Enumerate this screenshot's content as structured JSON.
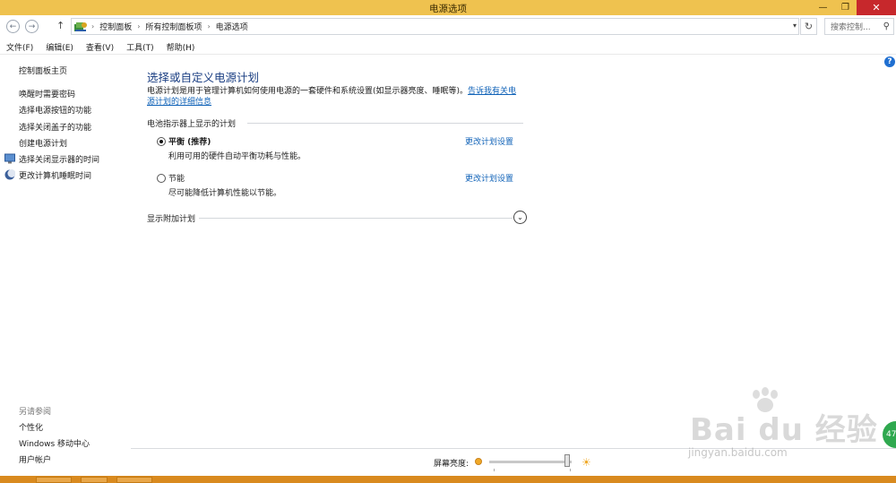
{
  "window": {
    "title": "电源选项",
    "minimize": "—",
    "restore": "❐",
    "close": "✕"
  },
  "nav": {
    "back": "←",
    "forward": "→",
    "up": "↑",
    "breadcrumb": [
      "控制面板",
      "所有控制面板项",
      "电源选项"
    ],
    "breadcrumb_sep": "›",
    "dropdown": "▾",
    "refresh": "↻",
    "search_placeholder": "搜索控制...",
    "search_icon": "⚲"
  },
  "menu": [
    "文件(F)",
    "编辑(E)",
    "查看(V)",
    "工具(T)",
    "帮助(H)"
  ],
  "sidebar": {
    "home": "控制面板主页",
    "links": [
      "唤醒时需要密码",
      "选择电源按钮的功能",
      "选择关闭盖子的功能",
      "创建电源计划",
      "选择关闭显示器的时间",
      "更改计算机睡眠时间"
    ],
    "see_also_title": "另请参阅",
    "see_also": [
      "个性化",
      "Windows 移动中心",
      "用户帐户"
    ]
  },
  "main": {
    "heading": "选择或自定义电源计划",
    "description": "电源计划是用于管理计算机如何使用电源的一套硬件和系统设置(如显示器亮度、睡眠等)。",
    "description_link": "告诉我有关电源计划的详细信息",
    "section_battery": "电池指示器上显示的计划",
    "plans": [
      {
        "name": "平衡 (推荐)",
        "description": "利用可用的硬件自动平衡功耗与性能。",
        "selected": true,
        "change": "更改计划设置"
      },
      {
        "name": "节能",
        "description": "尽可能降低计算机性能以节能。",
        "selected": false,
        "change": "更改计划设置"
      }
    ],
    "section_more": "显示附加计划",
    "expand_icon": "⌄",
    "help": "?"
  },
  "bottom": {
    "brightness_label": "屏幕亮度:",
    "brightness_level": 0.95,
    "sun_big": "☀"
  },
  "watermark": {
    "text": "Bai du 经验",
    "sub": "jingyan.baidu.com"
  },
  "badge": "47"
}
